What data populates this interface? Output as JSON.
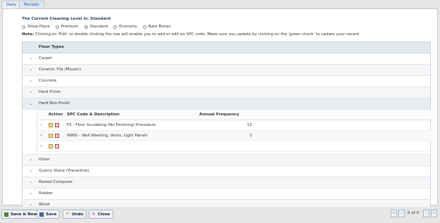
{
  "tabs": [
    {
      "label": "Daily"
    },
    {
      "label": "Periodic"
    }
  ],
  "cleaning_level_text": "The Current Cleaning Level is: Standard",
  "levels": [
    {
      "label": "Show Place",
      "selected": false
    },
    {
      "label": "Premium",
      "selected": false
    },
    {
      "label": "Standard",
      "selected": true
    },
    {
      "label": "Economy",
      "selected": false
    },
    {
      "label": "Bare Bones",
      "selected": false
    }
  ],
  "note": {
    "prefix": "Note:",
    "text": " Clicking on 'Edit' or double clicking the row will enable you to add or edit an SPC code. Make sure you update by clicking on the 'green check' to update your record"
  },
  "grid": {
    "header": "Floor Types",
    "rows_before": [
      "Carpet",
      "Ceramic Tile (Mosaic)",
      "Concrete",
      "Hard Finish"
    ],
    "expanded_row": "Hard Non-Finish",
    "rows_after": [
      "Other",
      "Quarry Stone (Travertine)",
      "Raised Computer",
      "Rubber",
      "Wood"
    ]
  },
  "subgrid": {
    "headers": {
      "action": "Action",
      "spc": "SPC Code & Description",
      "freq": "Annual Frequency"
    },
    "rows": [
      {
        "spc": "FS - Floor Scrubbing (No Finishing) Procedure",
        "freq": "12"
      },
      {
        "spc": "WWG - Wall Washing, Vents, Light Panels",
        "freq": "1"
      },
      {
        "spc": "",
        "freq": ""
      }
    ]
  },
  "footer": {
    "save_new": "Save & New",
    "save": "Save",
    "undo": "Undo",
    "close": "Close",
    "pager_text": "0 of 0"
  }
}
